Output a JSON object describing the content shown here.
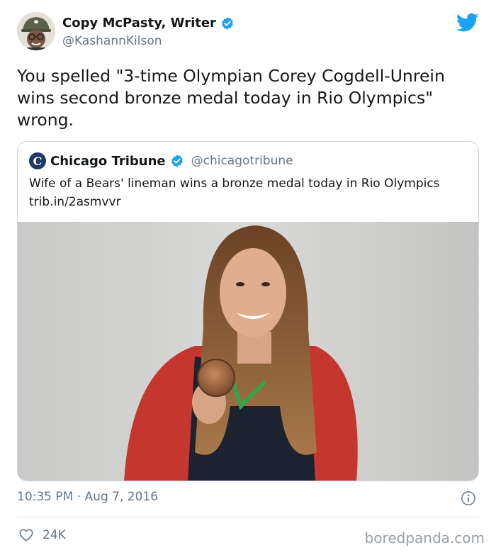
{
  "tweet": {
    "author_name": "Copy McPasty, Writer",
    "author_handle": "@KashannKilson",
    "text": "You spelled \"3-time Olympian Corey Cogdell-Unrein wins second bronze medal today in Rio Olympics\" wrong.",
    "time": "10:35 PM",
    "separator": "·",
    "date": "Aug 7, 2016",
    "likes": "24K"
  },
  "quoted": {
    "logo_letter": "C",
    "name": "Chicago Tribune",
    "handle": "@chicagotribune",
    "text": "Wife of a Bears' lineman wins a bronze medal today in Rio Olympics trib.in/2asmvvr"
  },
  "watermark": "boredpanda.com",
  "icons": [
    "verified-badge-icon",
    "twitter-bird-icon",
    "info-icon",
    "heart-icon"
  ],
  "colors": {
    "twitter_blue": "#1da1f2",
    "text": "#14171a",
    "secondary": "#657786",
    "border": "#ccd6dd"
  }
}
